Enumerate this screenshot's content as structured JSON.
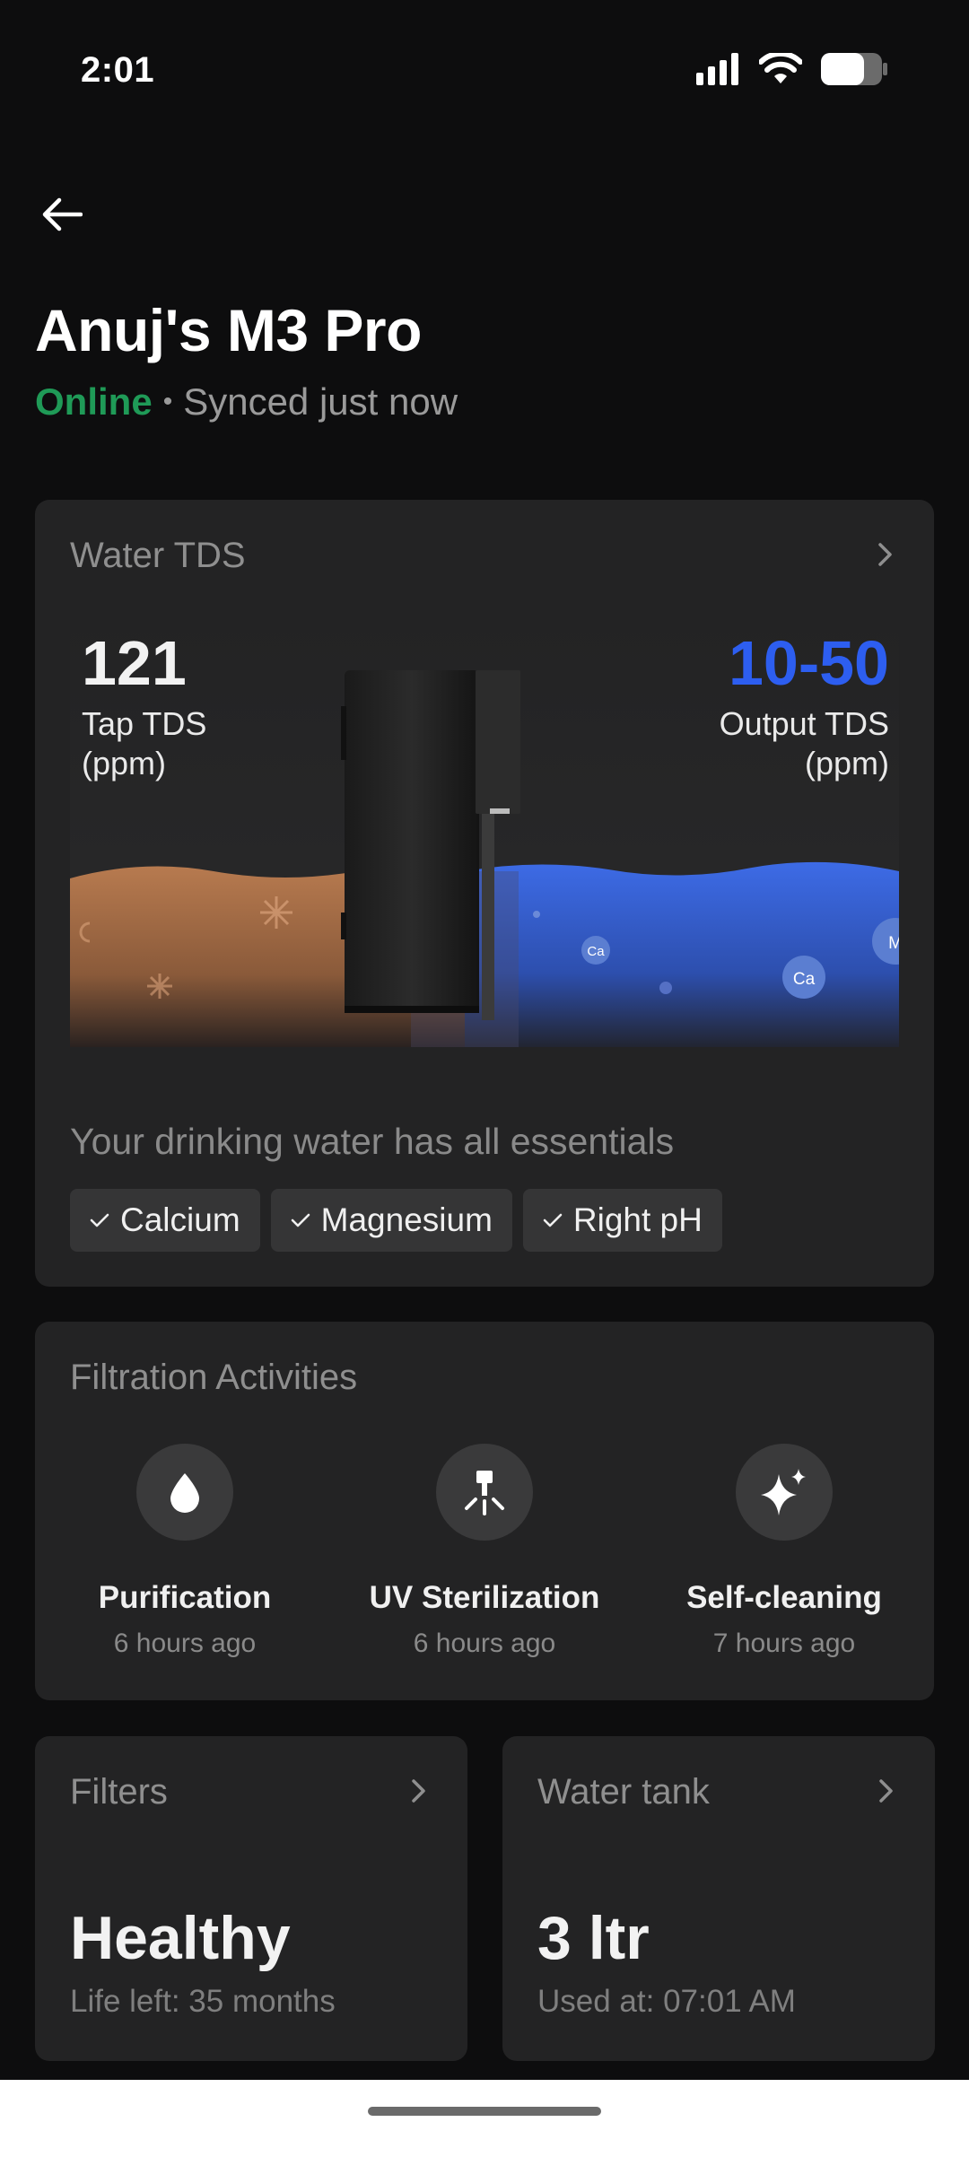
{
  "status_bar": {
    "time": "2:01"
  },
  "header": {
    "title": "Anuj's M3 Pro",
    "status": "Online",
    "sync": "Synced just now"
  },
  "tds": {
    "title": "Water TDS",
    "tap_value": "121",
    "tap_label_1": "Tap TDS",
    "tap_label_2": "(ppm)",
    "output_value": "10-50",
    "output_label_1": "Output TDS",
    "output_label_2": "(ppm)",
    "mineral_1": "Ca",
    "mineral_2": "Ca",
    "mineral_3": "M",
    "essentials_text": "Your drinking water has all essentials",
    "essentials": [
      "Calcium",
      "Magnesium",
      "Right pH"
    ],
    "colors": {
      "output_accent": "#2d5ef0",
      "tap_water": "#b77a4f",
      "output_water": "#3763d8"
    }
  },
  "filtration": {
    "title": "Filtration Activities",
    "activities": [
      {
        "name": "Purification",
        "time": "6 hours ago",
        "icon": "water-drop-icon"
      },
      {
        "name": "UV Sterilization",
        "time": "6 hours ago",
        "icon": "uv-lamp-icon"
      },
      {
        "name": "Self-cleaning",
        "time": "7 hours ago",
        "icon": "sparkle-icon"
      }
    ]
  },
  "filters": {
    "title": "Filters",
    "value": "Healthy",
    "sub": "Life left: 35 months"
  },
  "tank": {
    "title": "Water tank",
    "value": "3 ltr",
    "sub": "Used at: 07:01 AM"
  },
  "colors": {
    "online": "#1f9a57",
    "background": "#0d0d0e",
    "card": "#232324"
  }
}
